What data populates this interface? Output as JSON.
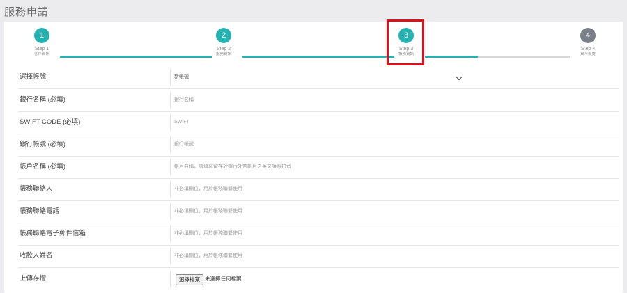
{
  "page": {
    "title": "服務申請"
  },
  "steps": [
    {
      "number": "1",
      "label": "Step 1",
      "sub": "客戶資訊",
      "state": "active"
    },
    {
      "number": "2",
      "label": "Step 2",
      "sub": "服務資訊",
      "state": "active"
    },
    {
      "number": "3",
      "label": "Step 3",
      "sub": "帳務資訊",
      "state": "active"
    },
    {
      "number": "4",
      "label": "Step 4",
      "sub": "資料預覽",
      "state": "inactive"
    }
  ],
  "colors": {
    "accent": "#26b2b0",
    "inactive": "#7a8088",
    "highlight": "#e0101a"
  },
  "form": {
    "account_select": {
      "label": "選擇帳號",
      "value": "新帳號"
    },
    "bank_name": {
      "label": "銀行名稱 (必填)",
      "placeholder": "銀行名稱"
    },
    "swift_code": {
      "label": "SWIFT CODE (必填)",
      "placeholder": "SWIFT"
    },
    "bank_account": {
      "label": "銀行帳號 (必填)",
      "placeholder": "銀行帳號"
    },
    "account_name": {
      "label": "帳戶名稱 (必填)",
      "placeholder": "帳戶名稱，請填寫留存於銀行外幣帳戶之英文護照拼音"
    },
    "billing_contact": {
      "label": "帳務聯絡人",
      "placeholder": "非必填欄位，用於帳務聯繫使用"
    },
    "billing_phone": {
      "label": "帳務聯絡電話",
      "placeholder": "非必填欄位，用於帳務聯繫使用"
    },
    "billing_email": {
      "label": "帳務聯絡電子郵件信箱",
      "placeholder": "非必填欄位，用於帳務聯繫使用"
    },
    "payee_name": {
      "label": "收款人姓名",
      "placeholder": "非必填欄位，用於帳務聯繫使用"
    },
    "upload": {
      "label": "上傳存摺",
      "button": "選擇檔案",
      "status": "未選擇任何檔案"
    }
  }
}
